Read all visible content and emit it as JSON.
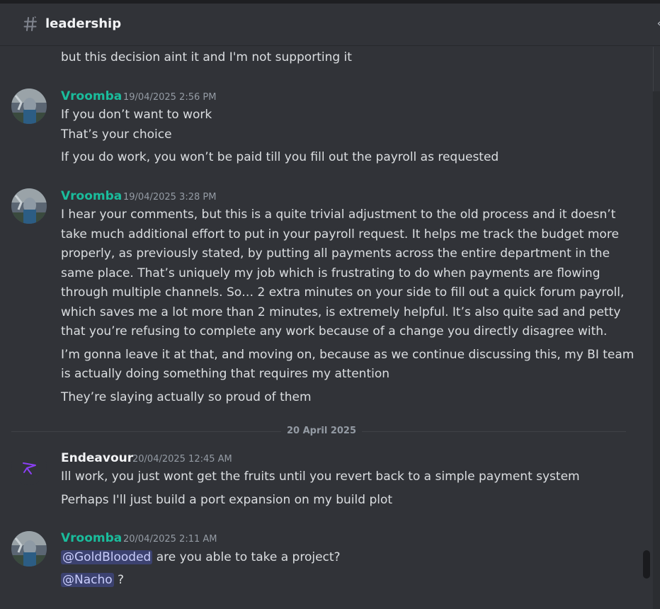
{
  "header": {
    "channel": "leadership"
  },
  "messages": {
    "prev_tail": "but this decision aint it and I'm not supporting it",
    "m1": {
      "author": "Vroomba",
      "time": "19/04/2025 2:56 PM",
      "lines": [
        "If you don’t want to work",
        "That’s your choice",
        "If you do work, you won’t be paid till you fill out the payroll as requested"
      ]
    },
    "m2": {
      "author": "Vroomba",
      "time": "19/04/2025 3:28 PM",
      "lines": [
        "I hear your comments, but this is a quite trivial adjustment to the old process and it doesn’t",
        "take much additional effort to put in your payroll request. It helps me track the budget more",
        "properly, as previously stated, by putting all payments across the entire department in the",
        "same place. That’s uniquely my job which is frustrating to do when payments are flowing",
        "through multiple channels. So… 2 extra minutes on your side to fill out a quick forum payroll,",
        "which saves me a lot more than 2 minutes, is extremely helpful. It’s also quite sad and petty",
        "that you’re refusing to complete any work because of a change you directly disagree with.",
        "I’m gonna leave it at that, and moving on, because as we continue discussing this, my BI team",
        "is actually doing something that requires my attention",
        "They’re slaying actually so proud of them"
      ]
    },
    "date_divider": "20 April 2025",
    "m3": {
      "author": "Endeavour",
      "time": "20/04/2025 12:45 AM",
      "lines": [
        "Ill work, you just wont get the fruits until you revert back to a simple payment system",
        "Perhaps I'll just build a port expansion on my build plot"
      ]
    },
    "m4": {
      "author": "Vroomba",
      "time": "20/04/2025 2:11 AM",
      "mention1": "@GoldBlooded",
      "line1_rest": " are you able to take a project?",
      "mention2": "@Nacho",
      "line2_rest": " ?"
    }
  },
  "colors": {
    "background": "#313338",
    "teal_author": "#1abc9c",
    "mention_bg": "#3c4270",
    "mention_text": "#c9cdfb",
    "endeavour_icon": "#8b3ff5"
  },
  "icons": {
    "channel": "hash-icon",
    "endeavour_avatar": "paper-plane-icon"
  }
}
